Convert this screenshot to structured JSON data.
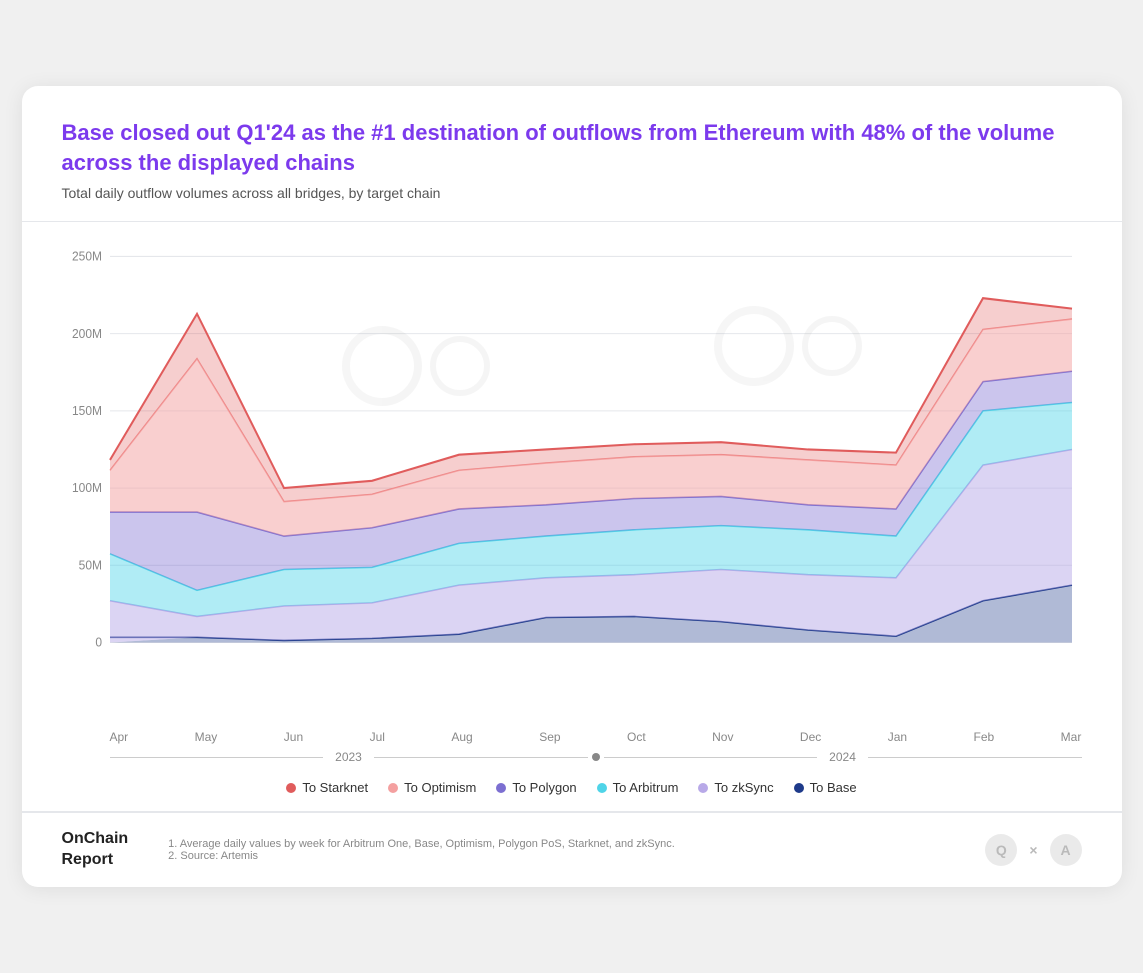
{
  "header": {
    "title": "Base closed out Q1'24 as the #1 destination of outflows from Ethereum with 48% of the volume across the displayed chains",
    "subtitle": "Total daily outflow volumes across all bridges, by target chain"
  },
  "yAxis": {
    "labels": [
      "250M",
      "200M",
      "150M",
      "100M",
      "50M",
      "0"
    ]
  },
  "xAxis": {
    "labels": [
      "Apr",
      "May",
      "Jun",
      "Jul",
      "Aug",
      "Sep",
      "Oct",
      "Nov",
      "Dec",
      "Jan",
      "Feb",
      "Mar"
    ]
  },
  "yearLabels": {
    "left": "2023",
    "right": "2024"
  },
  "legend": [
    {
      "label": "To Starknet",
      "color": "#e05c5c"
    },
    {
      "label": "To Optimism",
      "color": "#f4a0a0"
    },
    {
      "label": "To Polygon",
      "color": "#7c6fd1"
    },
    {
      "label": "To Arbitrum",
      "color": "#4fd4e8"
    },
    {
      "label": "To zkSync",
      "color": "#b8a9e8"
    },
    {
      "label": "To Base",
      "color": "#1e3a8a"
    }
  ],
  "footer": {
    "brand": "OnChain\nReport",
    "notes": [
      "1. Average daily values by week for Arbitrum One, Base, Optimism, Polygon PoS, Starknet, and zkSync.",
      "2. Source: Artemis"
    ]
  }
}
